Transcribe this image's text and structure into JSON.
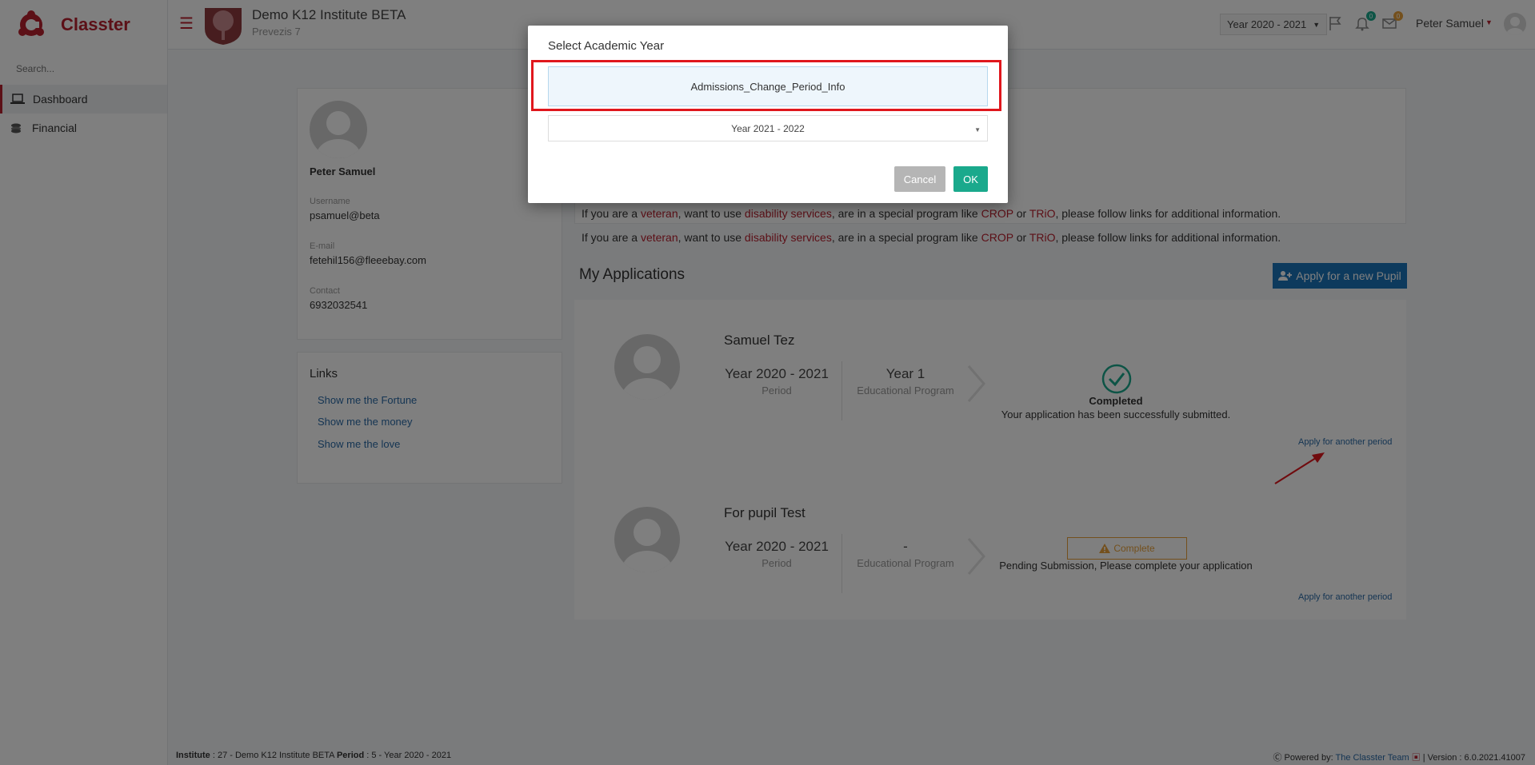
{
  "app": {
    "logo_text": "Classter",
    "search_placeholder": "Search..."
  },
  "sidebar": {
    "items": [
      {
        "label": "Dashboard",
        "icon": "laptop-icon"
      },
      {
        "label": "Financial",
        "icon": "coins-icon"
      }
    ]
  },
  "header": {
    "institute_name": "Demo K12 Institute BETA",
    "institute_sub": "Prevezis 7",
    "year_select": "Year 2020 - 2021",
    "flag_icon": "flag-icon",
    "notifications_count": "0",
    "messages_count": "0",
    "user_name": "Peter Samuel",
    "accent": "#b8202e"
  },
  "profile": {
    "name": "Peter Samuel",
    "username_label": "Username",
    "username": "psamuel@beta",
    "email_label": "E-mail",
    "email": "fetehil156@fleeebay.com",
    "contact_label": "Contact",
    "contact": "6932032541"
  },
  "links": {
    "title": "Links",
    "items": [
      "Show me the Fortune",
      "Show me the money",
      "Show me the love"
    ]
  },
  "info": {
    "p1": "If you are a ",
    "veteran": "veteran",
    "p2": ", want to use ",
    "disability": "disability services",
    "p3": ", are in a special program like ",
    "crop": "CROP",
    "p4": " or ",
    "trio": "TRiO",
    "p5": ", please follow links for additional information."
  },
  "applications": {
    "title": "My Applications",
    "apply_new_label": "Apply for a new Pupil",
    "items": [
      {
        "name": "Samuel Tez",
        "period": "Year 2020 - 2021",
        "period_label": "Period",
        "program": "Year 1",
        "program_label": "Educational Program",
        "status": "Completed",
        "status_detail": "Your application has been successfully submitted.",
        "apply_another": "Apply for another period"
      },
      {
        "name": "For pupil Test",
        "period": "Year 2020 - 2021",
        "period_label": "Period",
        "program": "-",
        "program_label": "Educational Program",
        "status": "Complete",
        "status_detail": "Pending Submission, Please complete your application",
        "apply_another": "Apply for another period"
      }
    ]
  },
  "footer": {
    "institute_label": "Institute",
    "institute_value": ": 27 - Demo K12 Institute BETA",
    "period_label": "Period",
    "period_value": ": 5 - Year 2020 - 2021",
    "powered_label": "Powered by:",
    "powered_team": "The Classter Team",
    "version": "| Version : 6.0.2021.41007"
  },
  "modal": {
    "title": "Select Academic Year",
    "info": "Admissions_Change_Period_Info",
    "selected_year": "Year 2021 - 2022",
    "cancel_label": "Cancel",
    "ok_label": "OK"
  }
}
